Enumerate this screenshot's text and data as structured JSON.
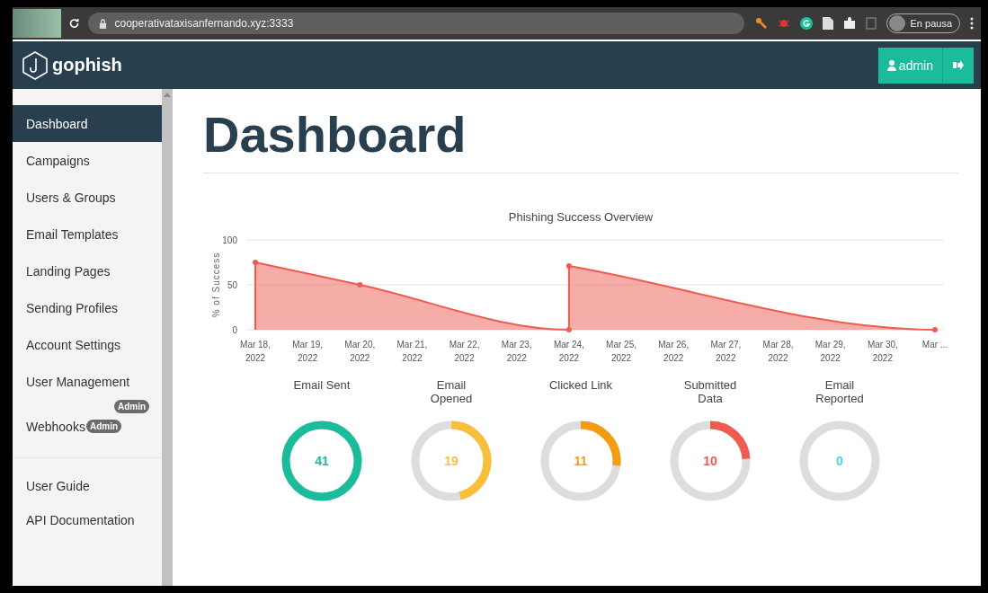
{
  "browser": {
    "url": "cooperativataxisanfernando.xyz:3333",
    "profile_status": "En pausa"
  },
  "navbar": {
    "brand": "gophish",
    "user_button": "admin"
  },
  "sidebar": {
    "items": [
      {
        "label": "Dashboard",
        "selected": true
      },
      {
        "label": "Campaigns",
        "selected": false
      },
      {
        "label": "Users & Groups",
        "selected": false
      },
      {
        "label": "Email Templates",
        "selected": false
      },
      {
        "label": "Landing Pages",
        "selected": false
      },
      {
        "label": "Sending Profiles",
        "selected": false
      },
      {
        "label": "Account Settings",
        "selected": false
      },
      {
        "label": "User Management",
        "selected": false,
        "badge": "Admin"
      },
      {
        "label": "Webhooks",
        "selected": false,
        "badge": "Admin"
      }
    ],
    "footer_items": [
      "User Guide",
      "API Documentation"
    ]
  },
  "page": {
    "title": "Dashboard"
  },
  "chart": {
    "chart_data": {
      "type": "area",
      "title": "Phishing Success Overview",
      "ylabel": "% of Success",
      "ylim": [
        0,
        100
      ],
      "yticks": [
        0,
        50,
        100
      ],
      "categories": [
        "Mar 18, 2022",
        "Mar 19, 2022",
        "Mar 20, 2022",
        "Mar 21, 2022",
        "Mar 22, 2022",
        "Mar 23, 2022",
        "Mar 24, 2022",
        "Mar 25, 2022",
        "Mar 26, 2022",
        "Mar 27, 2022",
        "Mar 28, 2022",
        "Mar 29, 2022",
        "Mar 30, 2022",
        "Mar ..."
      ],
      "series": [
        {
          "color": "#f05b4f",
          "values": [
            75,
            null,
            50,
            null,
            null,
            null,
            0,
            null,
            null,
            null,
            null,
            null,
            null,
            null
          ]
        },
        {
          "color": "#f05b4f",
          "values": [
            null,
            null,
            null,
            null,
            null,
            null,
            71,
            null,
            null,
            null,
            null,
            null,
            null,
            0
          ]
        }
      ]
    }
  },
  "stats": [
    {
      "label": "Email Sent",
      "value": "41",
      "level": 1,
      "color": "#1abc9c"
    },
    {
      "label": "Email Opened",
      "value": "19",
      "level": 0.46,
      "color": "#f9bf3b"
    },
    {
      "label": "Clicked Link",
      "value": "11",
      "level": 0.27,
      "color": "#f39c12"
    },
    {
      "label": "Submitted Data",
      "value": "10",
      "level": 0.24,
      "color": "#f05b4f"
    },
    {
      "label": "Email Reported",
      "value": "0",
      "level": 0,
      "color": "#3edbf0"
    }
  ]
}
